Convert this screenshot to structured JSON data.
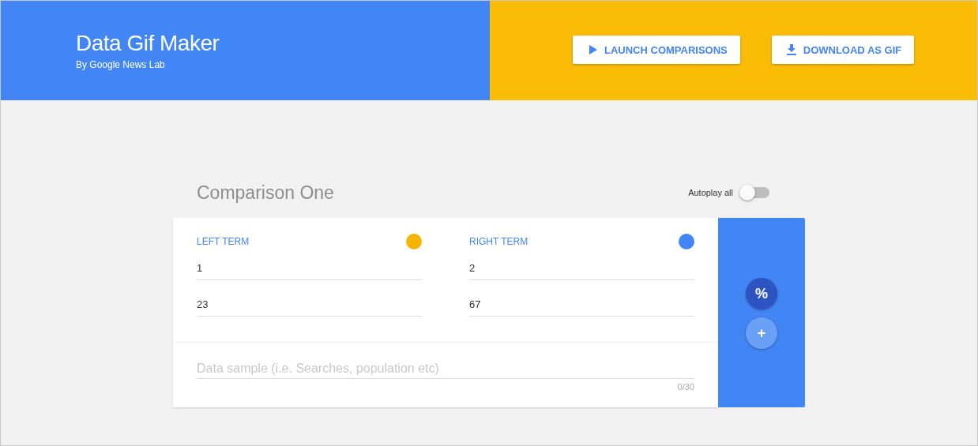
{
  "header": {
    "title": "Data Gif Maker",
    "subtitle": "By Google News Lab",
    "actions": [
      {
        "label": "LAUNCH COMPARISONS",
        "kind": "play"
      },
      {
        "label": "DOWNLOAD AS GIF",
        "kind": "download"
      }
    ]
  },
  "comparison": {
    "title": "Comparison One",
    "autoplay": {
      "label": "Autoplay all",
      "on": false
    },
    "terms": [
      {
        "label": "LEFT TERM",
        "color": "#f4b400",
        "values": [
          "1",
          "23"
        ]
      },
      {
        "label": "RIGHT TERM",
        "color": "#4285f4",
        "values": [
          "2",
          "67"
        ]
      }
    ],
    "sample": {
      "placeholder": "Data sample (i.e. Searches, population etc)",
      "counter": "0/30"
    },
    "modes": [
      {
        "label": "%",
        "selected": true
      },
      {
        "label": "+",
        "selected": false
      }
    ]
  }
}
